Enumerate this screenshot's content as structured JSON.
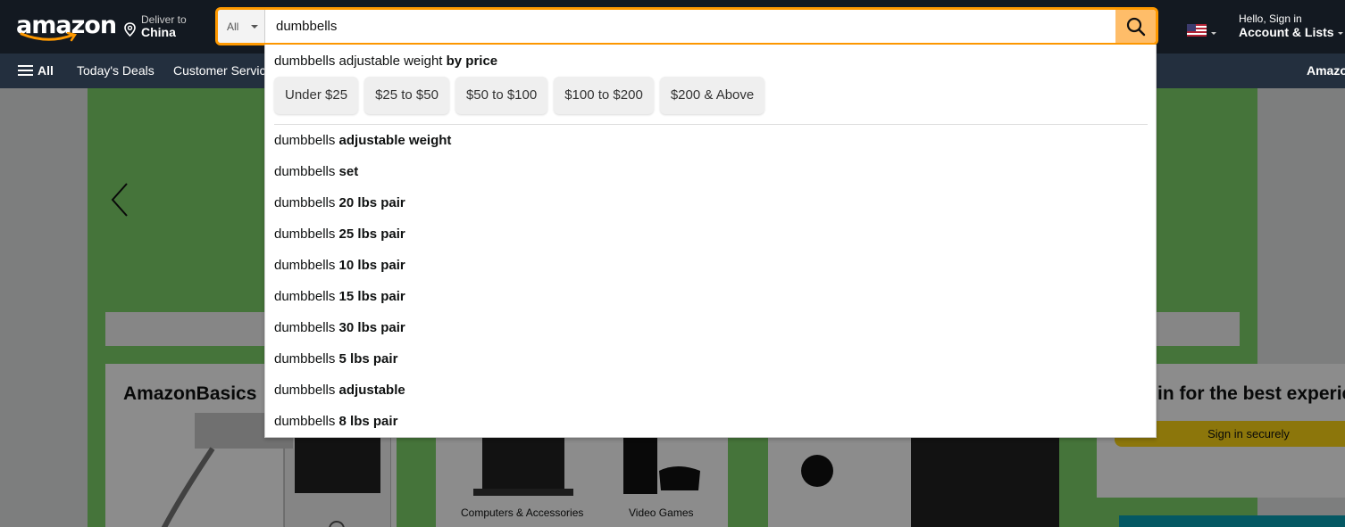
{
  "header": {
    "logo": "amazon",
    "deliver_line1": "Deliver to",
    "deliver_line2": "China",
    "search_category": "All",
    "search_value": "dumbbells",
    "account_line1": "Hello, Sign in",
    "account_line2": "Account & Lists"
  },
  "nav": {
    "all_label": "All",
    "items": [
      "Today's Deals",
      "Customer Servic"
    ],
    "right_label": "Amazo"
  },
  "dropdown": {
    "first": {
      "prefix": "dumbbells adjustable weight",
      "bold": "by price"
    },
    "price_chips": [
      "Under $25",
      "$25 to $50",
      "$50 to $100",
      "$100 to $200",
      "$200 & Above"
    ],
    "suggestions": [
      {
        "prefix": "dumbbells",
        "bold": "adjustable weight"
      },
      {
        "prefix": "dumbbells",
        "bold": "set"
      },
      {
        "prefix": "dumbbells",
        "bold": "20 lbs pair"
      },
      {
        "prefix": "dumbbells",
        "bold": "25 lbs pair"
      },
      {
        "prefix": "dumbbells",
        "bold": "10 lbs pair"
      },
      {
        "prefix": "dumbbells",
        "bold": "15 lbs pair"
      },
      {
        "prefix": "dumbbells",
        "bold": "30 lbs pair"
      },
      {
        "prefix": "dumbbells",
        "bold": "5 lbs pair"
      },
      {
        "prefix": "dumbbells",
        "bold": "adjustable"
      },
      {
        "prefix": "dumbbells",
        "bold": "8 lbs pair"
      }
    ]
  },
  "page": {
    "card1_title": "AmazonBasics",
    "card2_caption1": "Computers & Accessories",
    "card2_caption2": "Video Games",
    "signin_title": "in for the best experie",
    "signin_button": "Sign in securely"
  },
  "colors": {
    "header_bg": "#131921",
    "nav_bg": "#232f3e",
    "search_accent": "#febd69",
    "hero_green": "#7fd46b"
  }
}
